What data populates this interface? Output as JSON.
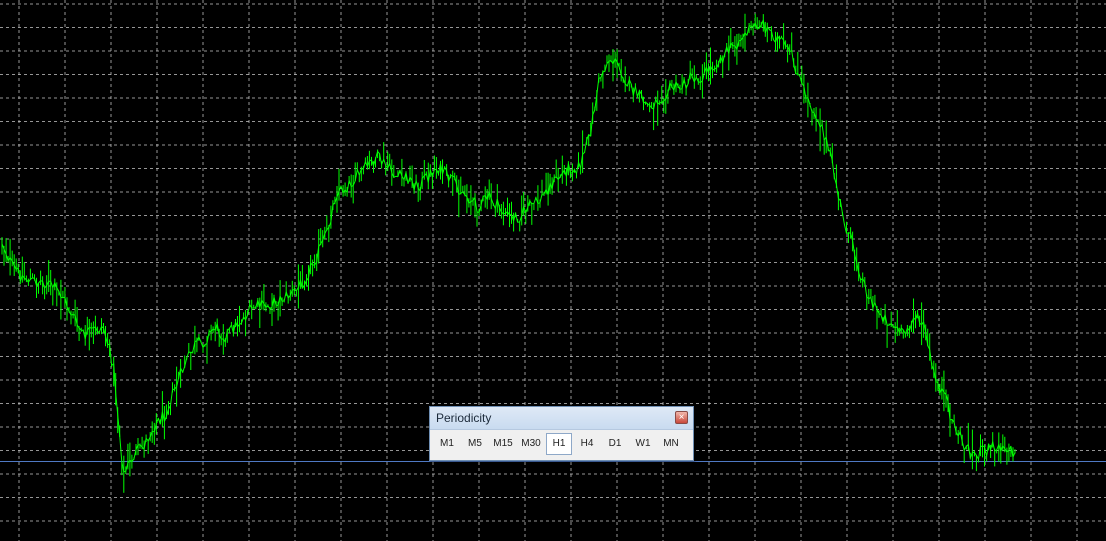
{
  "chart": {
    "background": "#000000",
    "grid_color": "#c8c8c8",
    "series_color": "#00ff00",
    "horizontal_line_color": "#4f79c4"
  },
  "chart_data": {
    "type": "line",
    "grid": true,
    "ylim": [
      0,
      100
    ],
    "series": [
      {
        "values": [
          55,
          50,
          48,
          47,
          47,
          46,
          44,
          40,
          36,
          37,
          38,
          30,
          8,
          12,
          14,
          18,
          20,
          25,
          30,
          34,
          35,
          38,
          36,
          38,
          40,
          42,
          42,
          43,
          44,
          45,
          48,
          52,
          56,
          65,
          66,
          68,
          70,
          72,
          70,
          68,
          68,
          66,
          68,
          70,
          68,
          66,
          64,
          62,
          64,
          62,
          60,
          60,
          62,
          63,
          66,
          68,
          70,
          70,
          76,
          88,
          92,
          90,
          86,
          84,
          82,
          84,
          86,
          86,
          88,
          88,
          90,
          92,
          94,
          96,
          98,
          99,
          97,
          95,
          92,
          86,
          82,
          78,
          70,
          60,
          54,
          47,
          42,
          40,
          38,
          36,
          40,
          38,
          28,
          24,
          18,
          14,
          12,
          13,
          14,
          14,
          12
        ]
      }
    ]
  },
  "toolbar": {
    "title": "Periodicity",
    "close_symbol": "×",
    "buttons": [
      {
        "label": "M1",
        "active": false
      },
      {
        "label": "M5",
        "active": false
      },
      {
        "label": "M15",
        "active": false
      },
      {
        "label": "M30",
        "active": false
      },
      {
        "label": "H1",
        "active": true
      },
      {
        "label": "H4",
        "active": false
      },
      {
        "label": "D1",
        "active": false
      },
      {
        "label": "W1",
        "active": false
      },
      {
        "label": "MN",
        "active": false
      }
    ]
  }
}
